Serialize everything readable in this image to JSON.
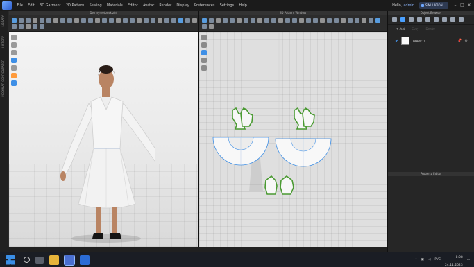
{
  "app": {
    "menu": [
      "File",
      "Edit",
      "3D Garment",
      "2D Pattern",
      "Sewing",
      "Materials",
      "Editor",
      "Avatar",
      "Render",
      "Display",
      "Preferences",
      "Settings",
      "Help"
    ],
    "user_greeting": "Hello,",
    "user_name": "admin",
    "simulation_label": "SIMULATION",
    "window_controls": [
      "–",
      "□",
      "✕"
    ],
    "accent_color": "#3e8fe6",
    "pattern_outline_color": "#4a9a32"
  },
  "left_strip": {
    "tabs": [
      "LIBRARY",
      "HISTORY",
      "MODULAR CONFIGURATOR"
    ]
  },
  "window_3d": {
    "title": "Dev nymetonsk.zfrf"
  },
  "window_2d": {
    "title": "2D Pattern Window"
  },
  "status_bar": {
    "text": "Version: 7.0.230 (r36851)"
  },
  "object_browser": {
    "title": "Object Browser",
    "tabs": [
      {
        "label": "+ Add",
        "enabled": true
      },
      {
        "label": "Copy",
        "enabled": false
      },
      {
        "label": "Delete",
        "enabled": false
      }
    ],
    "fabrics": [
      {
        "name": "FABRIC 1",
        "checked": true,
        "swatch_color": "#fafafa"
      }
    ]
  },
  "property_editor": {
    "title": "Property Editor"
  },
  "taskbar": {
    "apps": [
      {
        "name": "start-button",
        "color": "#3a8ee6"
      },
      {
        "name": "search-button",
        "color": "#5a5f6a"
      },
      {
        "name": "task-view-button",
        "color": "#5a5f6a"
      },
      {
        "name": "file-explorer-button",
        "color": "#e7b43a"
      },
      {
        "name": "clo-app-button",
        "color": "#4a6fd0"
      },
      {
        "name": "word-app-button",
        "color": "#2b6cd6"
      }
    ],
    "language": "РУС",
    "time": "8:08",
    "date": "24.11.2023"
  }
}
